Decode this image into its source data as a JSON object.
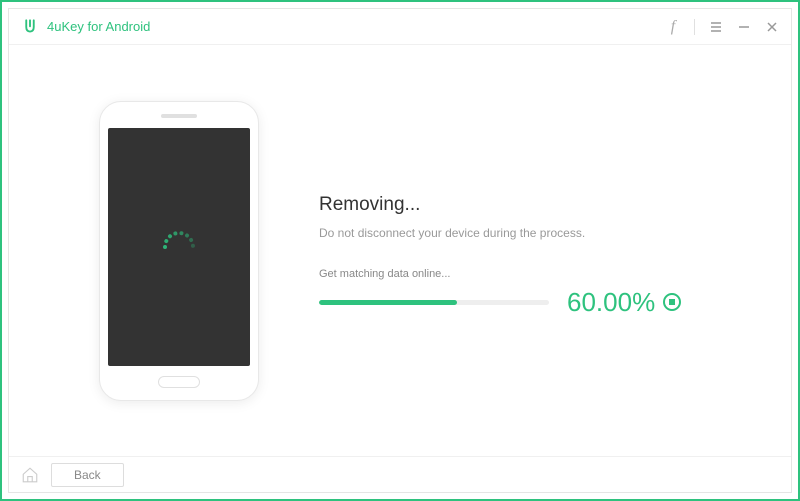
{
  "app": {
    "title": "4uKey for Android"
  },
  "progress": {
    "title": "Removing...",
    "subtitle": "Do not disconnect your device during the process.",
    "status": "Get matching data online...",
    "percent_text": "60.00%",
    "percent_value": 60,
    "fill_width": "60%"
  },
  "footer": {
    "back_label": "Back"
  },
  "colors": {
    "accent": "#2ec27e"
  }
}
